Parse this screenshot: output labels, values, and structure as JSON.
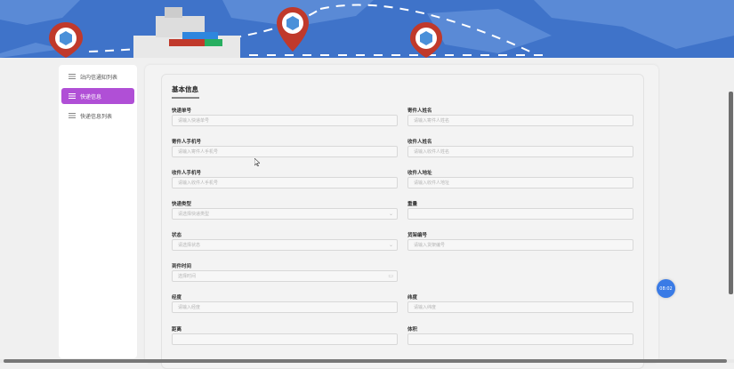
{
  "sidebar": {
    "items": [
      {
        "label": "站内信通知列表",
        "active": false,
        "icon": "list-icon"
      },
      {
        "label": "快递信息",
        "active": true,
        "icon": "list-icon"
      },
      {
        "label": "快递信息列表",
        "active": false,
        "icon": "list-icon"
      }
    ]
  },
  "form": {
    "title": "基本信息",
    "fields": [
      {
        "label": "快递单号",
        "placeholder": "请输入快递单号"
      },
      {
        "label": "寄件人姓名",
        "placeholder": "请输入寄件人姓名"
      },
      {
        "label": "寄件人手机号",
        "placeholder": "请输入寄件人手机号"
      },
      {
        "label": "收件人姓名",
        "placeholder": "请输入收件人姓名"
      },
      {
        "label": "收件人手机号",
        "placeholder": "请输入收件人手机号"
      },
      {
        "label": "收件人地址",
        "placeholder": "请输入收件人地址"
      },
      {
        "label": "快递类型",
        "placeholder": "请选择快递类型"
      },
      {
        "label": "重量",
        "placeholder": ""
      },
      {
        "label": "状态",
        "placeholder": "请选择状态"
      },
      {
        "label": "货架编号",
        "placeholder": "请输入货架编号"
      },
      {
        "label": "到件时间",
        "placeholder": "选择时间"
      },
      {
        "label": "经度",
        "placeholder": "请输入经度"
      },
      {
        "label": "纬度",
        "placeholder": "请输入纬度"
      },
      {
        "label": "距离",
        "placeholder": ""
      },
      {
        "label": "体积",
        "placeholder": ""
      }
    ]
  },
  "float_button": {
    "label": "08:02"
  },
  "colors": {
    "banner": "#3f73c9",
    "accent": "#b04fd6",
    "float": "#3a7be6"
  }
}
